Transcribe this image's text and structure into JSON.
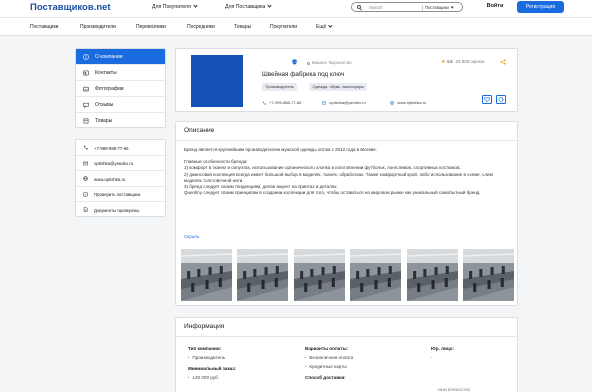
{
  "header": {
    "logo": "Поставщиков.net",
    "for_buyers": "Для Покупателя",
    "for_suppliers": "Для Поставщика",
    "search_placeholder": "Search",
    "search_category": "Поставщики",
    "login": "Войти",
    "register": "Регистрация"
  },
  "nav": {
    "items": [
      "Поставщики",
      "Производители",
      "Перевозчики",
      "Посредники",
      "Товары",
      "Покупатели"
    ],
    "more": "Ещё"
  },
  "side_menu": [
    {
      "label": "О компании",
      "icon": "info-icon",
      "active": true
    },
    {
      "label": "Контакты",
      "icon": "contacts-icon",
      "active": false
    },
    {
      "label": "Фотографии",
      "icon": "photo-icon",
      "active": false
    },
    {
      "label": "Отзывы",
      "icon": "reviews-icon",
      "active": false
    },
    {
      "label": "Товары",
      "icon": "goods-icon",
      "active": false
    }
  ],
  "side_contacts": [
    {
      "label": "+7-999-888-77-66",
      "icon": "phone-icon"
    },
    {
      "label": "optishka@yandex.ru",
      "icon": "mail-icon"
    },
    {
      "label": "www.optishka.ru",
      "icon": "globe-icon"
    },
    {
      "label": "Проверить поставщика",
      "icon": "check-icon"
    },
    {
      "label": "Документы проверены",
      "icon": "document-icon"
    }
  ],
  "company": {
    "location": "Бишкек, Кыргызстан",
    "name": "Швейная фабрика под ключ",
    "rating": "4.6",
    "reviews": "23 808 оценок",
    "tags": [
      "Производитель",
      "Одежда, обувь, аксессуары"
    ],
    "phone": "+7-999-888-77-66",
    "email": "optishka@yandex.ru",
    "website": "www.optishka.ru"
  },
  "description": {
    "title": "Описание",
    "intro": "Бренд               является крупнейшим производителем мужской одежды оптом с 2012 года в Москве.",
    "features_title": "Главные особенности бренда:",
    "features": [
      "1) комфорт в тканях и силуэтах, использование органического хлопка в изготовлении футболок, лонгсливов, спортивных костюмов;",
      "2) джинсовая коллекция всегда имеет большой выбор в моделях, тканях, обработках. Также комфортный крой, либо использование в схеме, слим моделях толстовочной нити.",
      "3) бренд следует своим тенденциям, делая акцент на принтах и деталях.",
      "Quentiny следует своим принципам в создании коллекции для того, чтобы оставаться на мировом рынке как уникальный самобытный бренд."
    ],
    "hide_link": "Скрыть"
  },
  "info": {
    "title": "Информация",
    "company_type_label": "Тип компании:",
    "company_type_value": "Производитель",
    "min_order_label": "Минимальный заказ:",
    "min_order_value": "120 000 руб.",
    "payment_label": "Варианты оплаты:",
    "payment_values": [
      "Безналичная оплата",
      "Кредитные карты"
    ],
    "delivery_label": "Способ доставки:",
    "legal_label": "Юр. лицо:",
    "legal_value": "-",
    "inn": "ИНН 6700012742"
  },
  "colors": {
    "accent": "#1a6ae0",
    "logo_text": "#1a4fa3",
    "company_logo": "#1452b8",
    "star": "#f0a000"
  }
}
